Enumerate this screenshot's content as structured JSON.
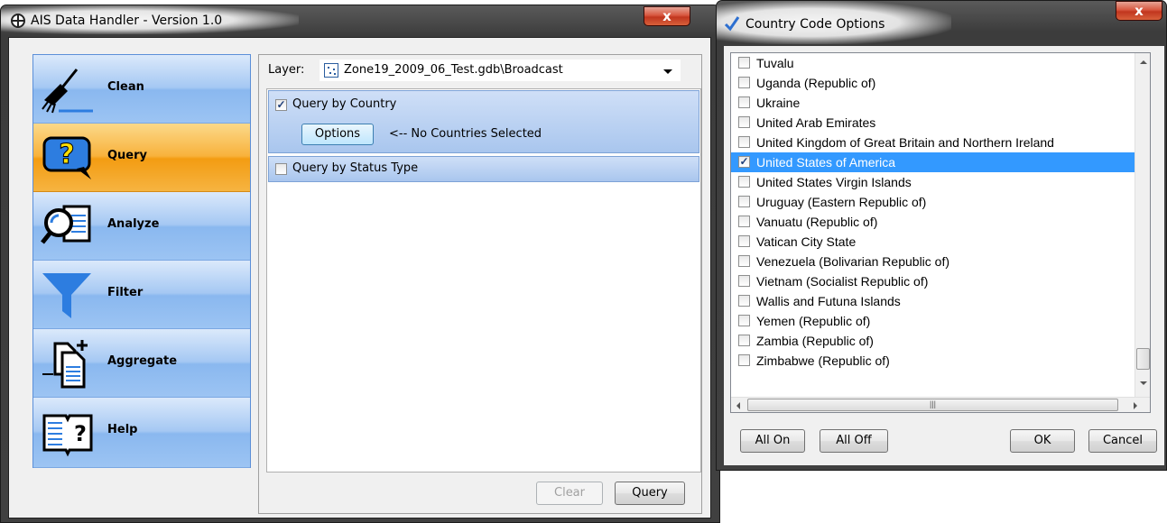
{
  "ais_window": {
    "title": "AIS Data Handler - Version 1.0",
    "close_label": "x",
    "nav": [
      {
        "label": "Clean",
        "icon": "broom-icon",
        "active": false
      },
      {
        "label": "Query",
        "icon": "question-bubble-icon",
        "active": true
      },
      {
        "label": "Analyze",
        "icon": "magnifier-document-icon",
        "active": false
      },
      {
        "label": "Filter",
        "icon": "funnel-icon",
        "active": false
      },
      {
        "label": "Aggregate",
        "icon": "documents-plus-icon",
        "active": false
      },
      {
        "label": "Help",
        "icon": "book-question-icon",
        "active": false
      }
    ],
    "layer": {
      "label": "Layer:",
      "value": "Zone19_2009_06_Test.gdb\\Broadcast"
    },
    "query_by_country": {
      "label": "Query by Country",
      "checked": true,
      "options_button": "Options",
      "status": "<-- No Countries Selected"
    },
    "query_by_status": {
      "label": "Query by Status Type",
      "checked": false
    },
    "buttons": {
      "clear": "Clear",
      "query": "Query"
    }
  },
  "country_window": {
    "title": "Country Code Options",
    "close_label": "x",
    "countries": [
      {
        "name": "Tuvalu",
        "checked": false
      },
      {
        "name": "Uganda (Republic of)",
        "checked": false
      },
      {
        "name": "Ukraine",
        "checked": false
      },
      {
        "name": "United Arab Emirates",
        "checked": false
      },
      {
        "name": "United Kingdom of Great Britain and Northern Ireland",
        "checked": false
      },
      {
        "name": "United States of America",
        "checked": true,
        "selected": true
      },
      {
        "name": "United States Virgin Islands",
        "checked": false
      },
      {
        "name": "Uruguay (Eastern Republic of)",
        "checked": false
      },
      {
        "name": "Vanuatu (Republic of)",
        "checked": false
      },
      {
        "name": "Vatican City State",
        "checked": false
      },
      {
        "name": "Venezuela (Bolivarian Republic of)",
        "checked": false
      },
      {
        "name": "Vietnam (Socialist Republic of)",
        "checked": false
      },
      {
        "name": "Wallis and Futuna Islands",
        "checked": false
      },
      {
        "name": "Yemen (Republic of)",
        "checked": false
      },
      {
        "name": "Zambia (Republic of)",
        "checked": false
      },
      {
        "name": "Zimbabwe (Republic of)",
        "checked": false
      }
    ],
    "buttons": {
      "all_on": "All On",
      "all_off": "All Off",
      "ok": "OK",
      "cancel": "Cancel"
    }
  },
  "colors": {
    "nav_active": "#f39c12",
    "nav_default": "#a5c8f3",
    "selection": "#3399ff"
  }
}
